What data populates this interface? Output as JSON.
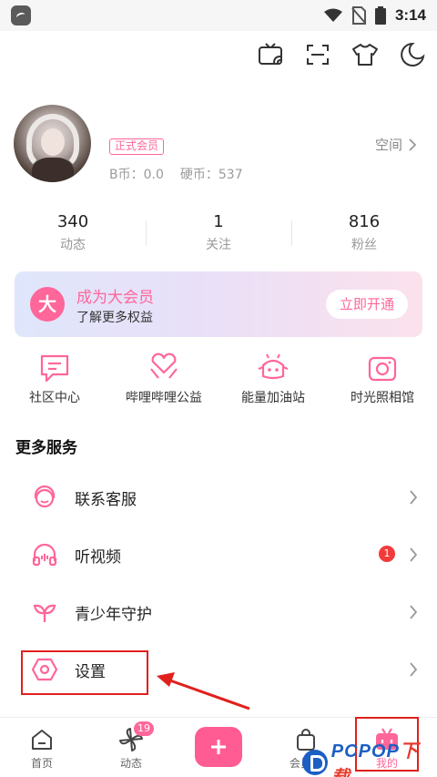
{
  "statusbar": {
    "time": "3:14"
  },
  "toolbar": {
    "icons": [
      "tv-cast-icon",
      "scan-icon",
      "tshirt-icon",
      "moon-icon"
    ]
  },
  "profile": {
    "vip_tag": "正式会员",
    "b_coin": "B币：0.0",
    "hard_coin": "硬币：537",
    "space_label": "空间"
  },
  "stats": [
    {
      "value": "340",
      "label": "动态"
    },
    {
      "value": "1",
      "label": "关注"
    },
    {
      "value": "816",
      "label": "粉丝"
    }
  ],
  "vip_banner": {
    "badge": "大",
    "title": "成为大会员",
    "subtitle": "了解更多权益",
    "button": "立即开通"
  },
  "quick_entries": [
    {
      "label": "社区中心",
      "icon": "community-chat-icon"
    },
    {
      "label": "哔哩哔哩公益",
      "icon": "heart-hands-icon"
    },
    {
      "label": "能量加油站",
      "icon": "energy-station-icon"
    },
    {
      "label": "时光照相馆",
      "icon": "camera-icon"
    }
  ],
  "more_services": {
    "title": "更多服务",
    "items": [
      {
        "label": "联系客服",
        "icon": "headset-icon",
        "badge": ""
      },
      {
        "label": "听视频",
        "icon": "headphones-icon",
        "badge": "1"
      },
      {
        "label": "青少年守护",
        "icon": "sprout-icon",
        "badge": ""
      },
      {
        "label": "设置",
        "icon": "settings-hexagon-icon",
        "badge": ""
      }
    ]
  },
  "bottom_nav": [
    {
      "label": "首页",
      "icon": "home-icon",
      "badge": ""
    },
    {
      "label": "动态",
      "icon": "pinwheel-icon",
      "badge": "19"
    },
    {
      "label": "",
      "icon": "plus-icon",
      "badge": ""
    },
    {
      "label": "会员购",
      "icon": "shopping-bag-icon",
      "badge": ""
    },
    {
      "label": "我的",
      "icon": "tv-mascot-icon",
      "badge": ""
    }
  ],
  "watermark": {
    "brand": "PCPOP",
    "suffix": "下载"
  },
  "colors": {
    "accent": "#ff6699",
    "annotation": "#e0201c"
  }
}
